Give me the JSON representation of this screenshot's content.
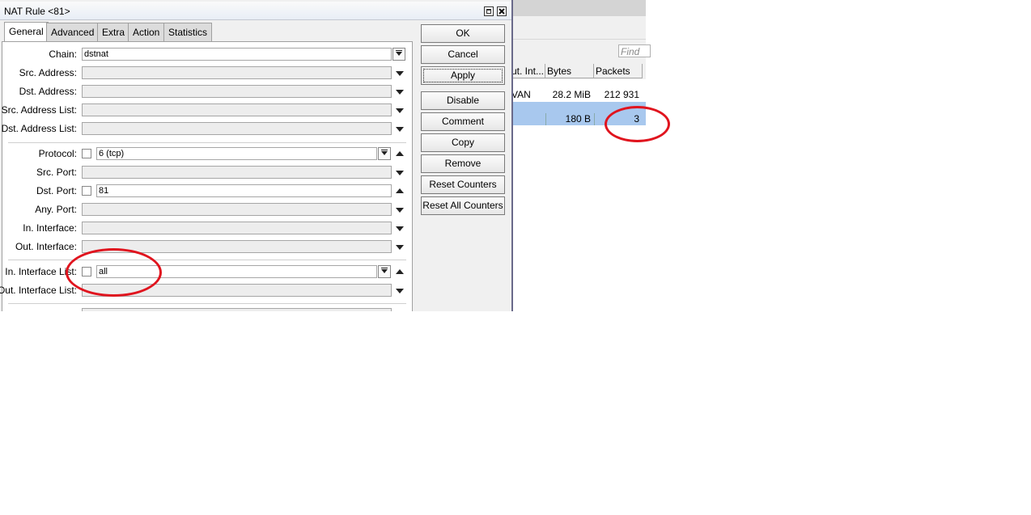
{
  "dialog": {
    "title": "NAT Rule <81>",
    "tabs": [
      "General",
      "Advanced",
      "Extra",
      "Action",
      "Statistics"
    ],
    "fields": {
      "chain": {
        "label": "Chain:",
        "value": "dstnat"
      },
      "src_address": {
        "label": "Src. Address:",
        "value": ""
      },
      "dst_address": {
        "label": "Dst. Address:",
        "value": ""
      },
      "src_address_list": {
        "label": "Src. Address List:",
        "value": ""
      },
      "dst_address_list": {
        "label": "Dst. Address List:",
        "value": ""
      },
      "protocol": {
        "label": "Protocol:",
        "value": "6 (tcp)"
      },
      "src_port": {
        "label": "Src. Port:",
        "value": ""
      },
      "dst_port": {
        "label": "Dst. Port:",
        "value": "81"
      },
      "any_port": {
        "label": "Any. Port:",
        "value": ""
      },
      "in_interface": {
        "label": "In. Interface:",
        "value": ""
      },
      "out_interface": {
        "label": "Out. Interface:",
        "value": ""
      },
      "in_interface_list": {
        "label": "In. Interface List:",
        "value": "all"
      },
      "out_interface_list": {
        "label": "Out. Interface List:",
        "value": ""
      }
    },
    "buttons": {
      "ok": "OK",
      "cancel": "Cancel",
      "apply": "Apply",
      "disable": "Disable",
      "comment": "Comment",
      "copy": "Copy",
      "remove": "Remove",
      "reset_counters": "Reset Counters",
      "reset_all_counters": "Reset All Counters"
    }
  },
  "background_list": {
    "find_placeholder": "Find",
    "columns": [
      "ut. Int...",
      "Bytes",
      "Packets"
    ],
    "rows": [
      {
        "interface": "VAN",
        "bytes": "28.2 MiB",
        "packets": "212 931",
        "selected": false
      },
      {
        "interface": "",
        "bytes": "",
        "packets": "",
        "selected": true
      },
      {
        "interface": "",
        "bytes": "180 B",
        "packets": "3",
        "selected": true
      }
    ]
  },
  "colors": {
    "highlight_ellipse": "#e0141e",
    "selected_row": "#a8c8ee",
    "dialog_bg": "#f0f0f0"
  }
}
